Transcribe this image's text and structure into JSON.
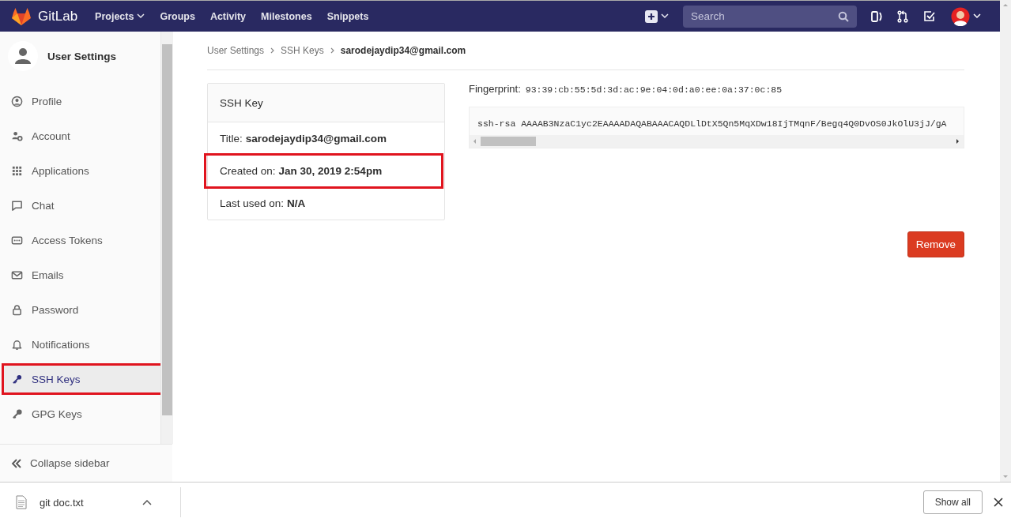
{
  "navbar": {
    "brand": "GitLab",
    "links": [
      {
        "label": "Projects",
        "dropdown": true
      },
      {
        "label": "Groups",
        "dropdown": false
      },
      {
        "label": "Activity",
        "dropdown": false
      },
      {
        "label": "Milestones",
        "dropdown": false
      },
      {
        "label": "Snippets",
        "dropdown": false
      }
    ],
    "search": {
      "placeholder": "Search"
    }
  },
  "sidebar": {
    "title": "User Settings",
    "items": [
      {
        "label": "Profile",
        "selected": false,
        "highlighted": false
      },
      {
        "label": "Account",
        "selected": false,
        "highlighted": false
      },
      {
        "label": "Applications",
        "selected": false,
        "highlighted": false
      },
      {
        "label": "Chat",
        "selected": false,
        "highlighted": false
      },
      {
        "label": "Access Tokens",
        "selected": false,
        "highlighted": false
      },
      {
        "label": "Emails",
        "selected": false,
        "highlighted": false
      },
      {
        "label": "Password",
        "selected": false,
        "highlighted": false
      },
      {
        "label": "Notifications",
        "selected": false,
        "highlighted": false
      },
      {
        "label": "SSH Keys",
        "selected": true,
        "highlighted": true
      },
      {
        "label": "GPG Keys",
        "selected": false,
        "highlighted": false
      }
    ],
    "collapse": "Collapse sidebar"
  },
  "breadcrumbs": [
    "User Settings",
    "SSH Keys",
    "sarodejaydip34@gmail.com"
  ],
  "card": {
    "header": "SSH Key",
    "rows": [
      {
        "label": "Title:",
        "value": "sarodejaydip34@gmail.com",
        "highlighted": false
      },
      {
        "label": "Created on:",
        "value": "Jan 30, 2019 2:54pm",
        "highlighted": true
      },
      {
        "label": "Last used on:",
        "value": "N/A",
        "highlighted": false
      }
    ]
  },
  "fingerprint": {
    "label": "Fingerprint:",
    "value": "93:39:cb:55:5d:3d:ac:9e:04:0d:a0:ee:0a:37:0c:85"
  },
  "key_text": "ssh-rsa AAAAB3NzaC1yc2EAAAADAQABAAACAQDLlDtX5Qn5MqXDw18IjTMqnF/Begq4Q0DvOS0JkOlU3jJ/gA",
  "remove_button": "Remove",
  "downloads": {
    "file": "git doc.txt",
    "show_all": "Show all"
  }
}
